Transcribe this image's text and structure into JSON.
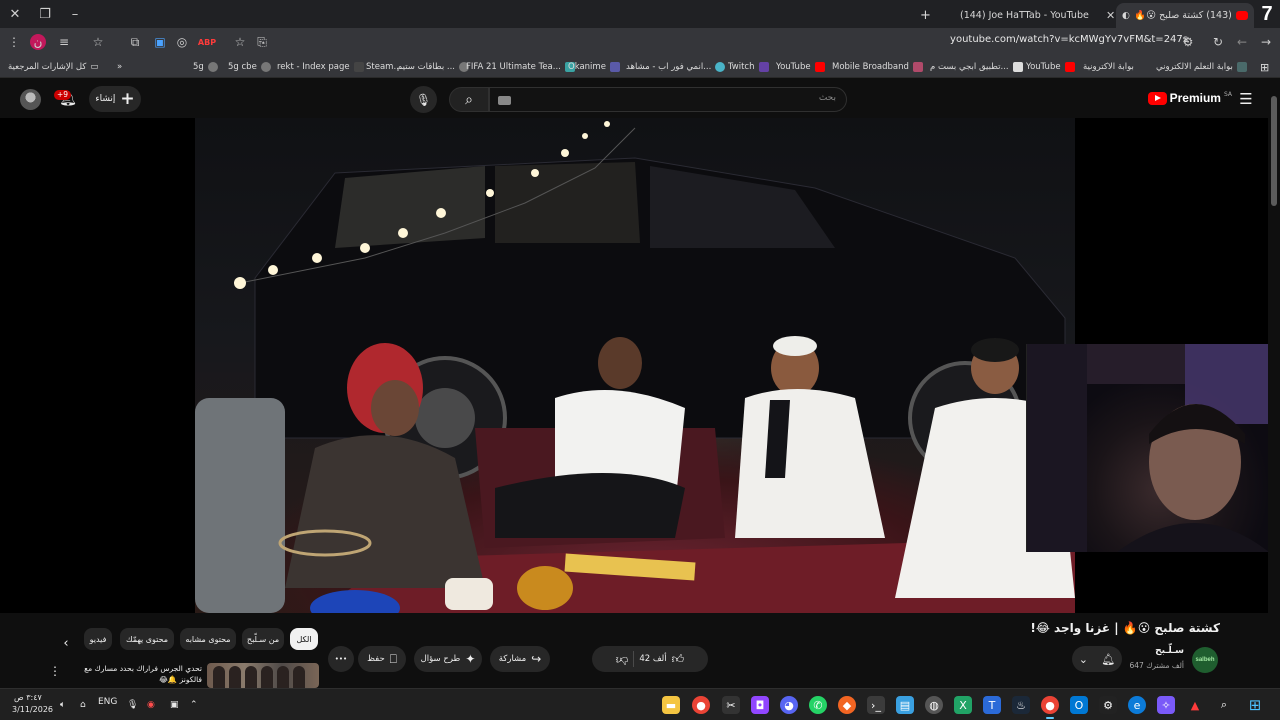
{
  "browser": {
    "window_number": "7",
    "tabs": [
      {
        "title": "(143) كشتة صلبح 😮🔥 | غز...",
        "active": true
      },
      {
        "title": "(144) Joe HaTTab - YouTube",
        "active": false
      }
    ],
    "new_tab_label": "+",
    "url": "youtube.com/watch?v=kcMWgYv7vFM&t=247s",
    "profile_initial": "ن"
  },
  "bookmarks": {
    "all_bookmarks_label": "كل الإشارات المرجعية",
    "overflow_label": "»",
    "items": [
      "5g",
      "5g cbe",
      "rekt - Index page",
      "Steam...",
      "بطاقات ستيم ...",
      "FIFA 21 Ultimate Tea...",
      "Okanime",
      "انمي فور اب - مشاهد...",
      "Twitch",
      "YouTube",
      "Mobile Broadband",
      "تطبيق ابجي بست م...",
      "YouTube",
      "بوابة الاكترونية",
      "بوابة التعلم الالكتروني"
    ]
  },
  "youtube": {
    "logo_text": "Premium",
    "region": "SA",
    "search_placeholder": "بحث",
    "create_label": "إنشاء",
    "notification_count": "+9",
    "video": {
      "title": "كشتة صلبح 😮🔥 | غزنا واجد 😂!",
      "channel_name": "سـلّـبح",
      "channel_avatar_text": "salbeh",
      "subscribers": "647 ألف مشترك",
      "like_count": "42 ألف",
      "share_label": "مشاركة",
      "ask_label": "طرح سؤال",
      "save_label": "حفظ",
      "more_label": "•••"
    },
    "chips": [
      "الكل",
      "من سـلّبح",
      "محتوى مشابه",
      "محتوى يهمّك",
      "فيديو"
    ],
    "recommendation": {
      "title": "تحدي الجرس فراراك بحدد مسارك مع فالكونز 🔔😂"
    }
  },
  "taskbar": {
    "time": "٣:٤٧ ص",
    "date": "3/11/2026",
    "language": "ENG"
  }
}
